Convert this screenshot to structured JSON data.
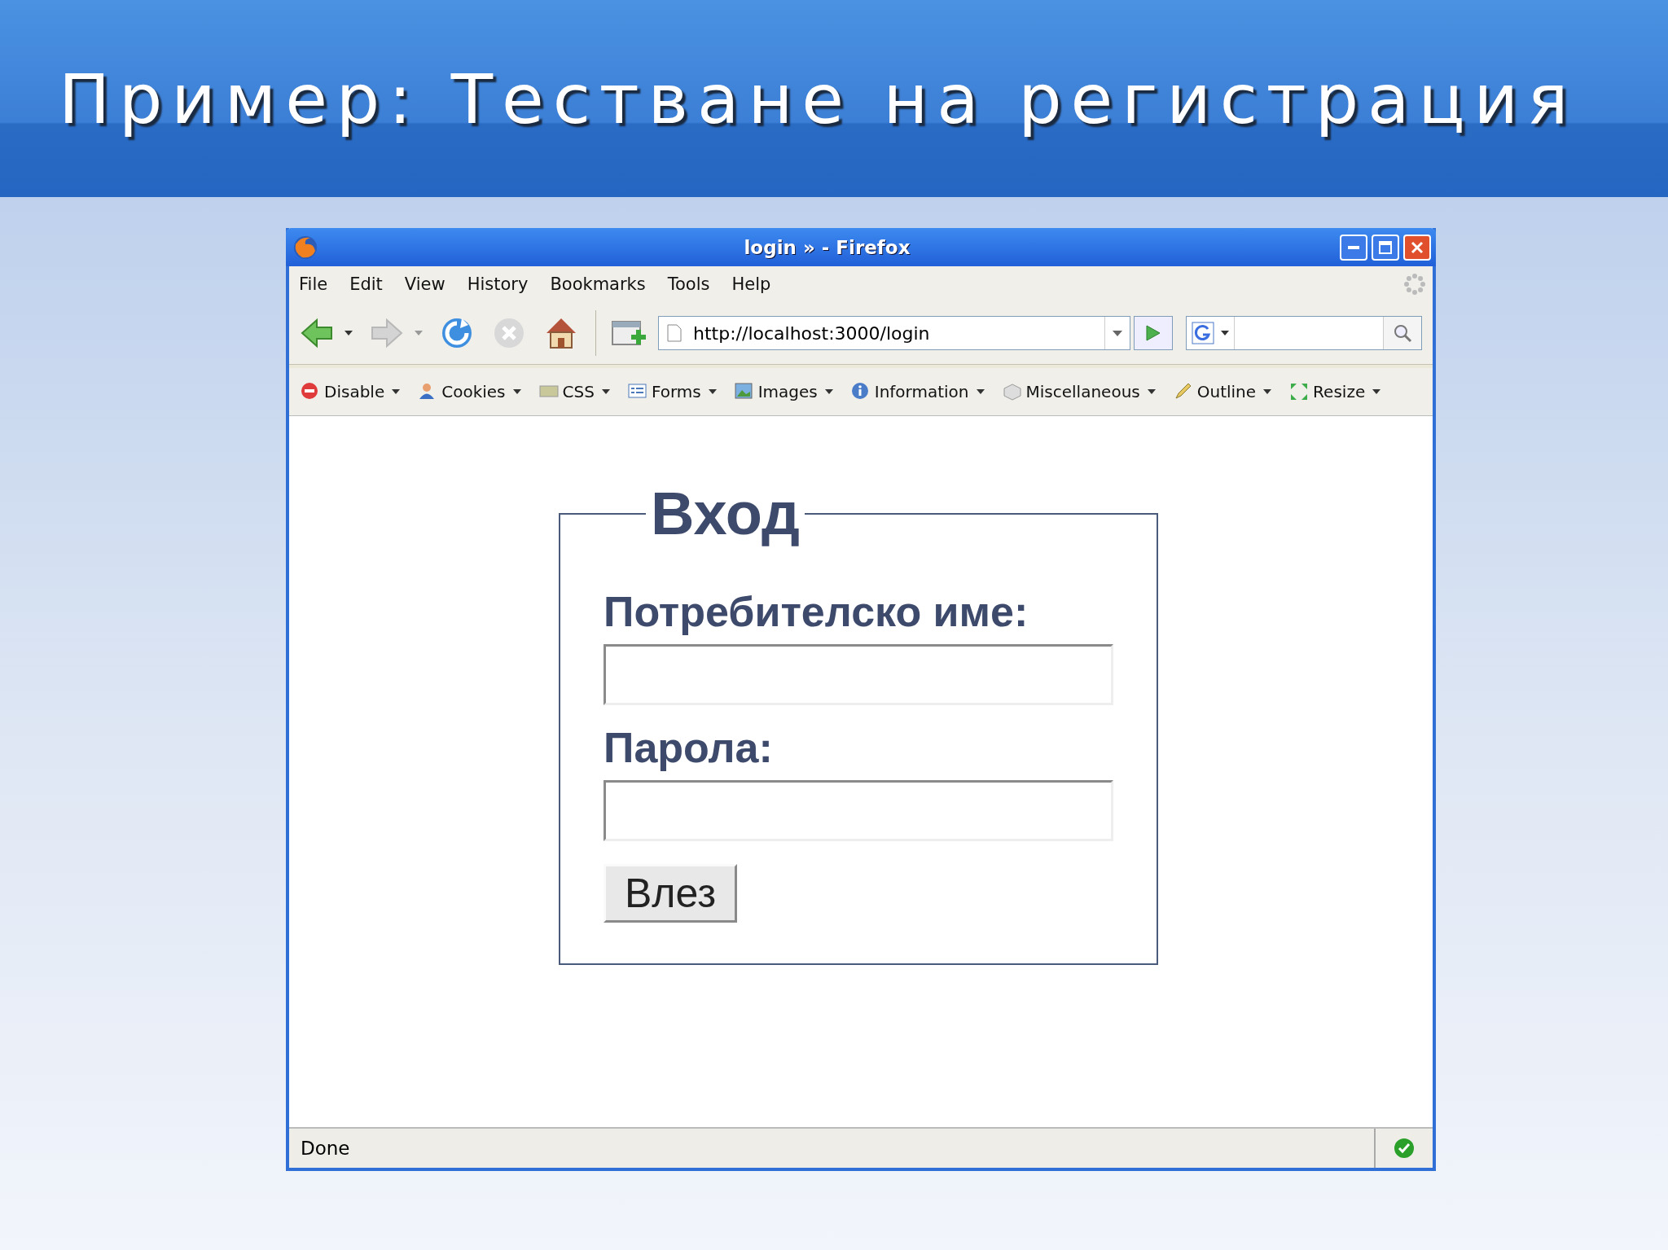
{
  "slide_title": "Пример: Тестване на регистрация",
  "window": {
    "title": "login » - Firefox"
  },
  "menu": [
    "File",
    "Edit",
    "View",
    "History",
    "Bookmarks",
    "Tools",
    "Help"
  ],
  "nav_buttons": [
    {
      "kind": "back",
      "disabled": false
    },
    {
      "kind": "forward",
      "disabled": true
    },
    {
      "kind": "reload",
      "disabled": false
    },
    {
      "kind": "stop",
      "disabled": true
    },
    {
      "kind": "home",
      "disabled": false
    }
  ],
  "address": {
    "value": "http://localhost:3000/login"
  },
  "dev_toolbar": [
    {
      "kind": "disable",
      "label": "Disable"
    },
    {
      "kind": "cookies",
      "label": "Cookies"
    },
    {
      "kind": "css",
      "label": "CSS"
    },
    {
      "kind": "forms",
      "label": "Forms"
    },
    {
      "kind": "images",
      "label": "Images"
    },
    {
      "kind": "information",
      "label": "Information"
    },
    {
      "kind": "misc",
      "label": "Miscellaneous"
    },
    {
      "kind": "outline",
      "label": "Outline"
    },
    {
      "kind": "resize",
      "label": "Resize"
    }
  ],
  "login_form": {
    "legend": "Вход",
    "fields": [
      {
        "label": "Потребителско име:"
      },
      {
        "label": "Парола:"
      }
    ],
    "button": "Влез"
  },
  "status_bar": {
    "text": "Done"
  }
}
